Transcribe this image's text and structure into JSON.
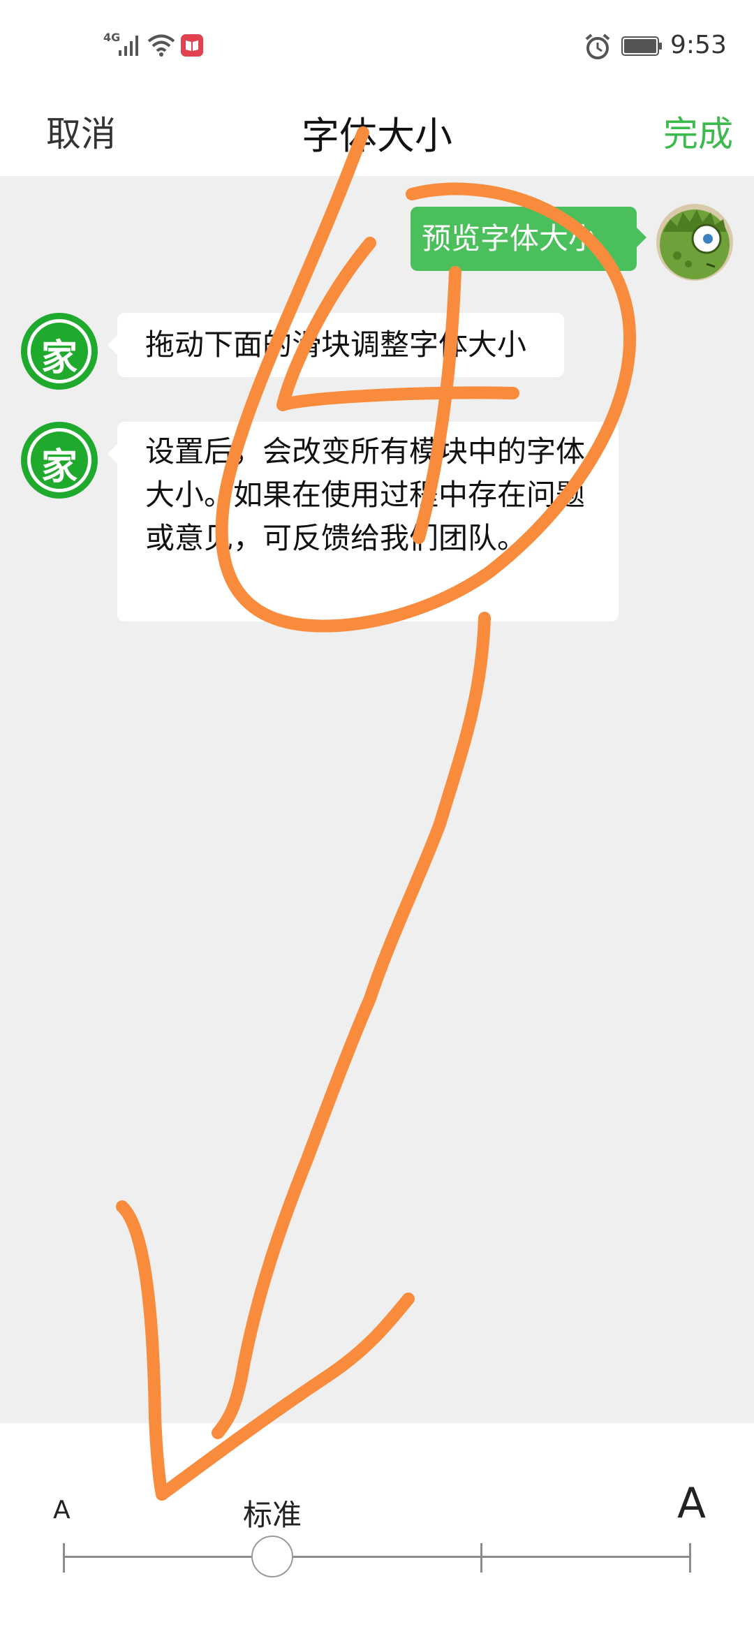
{
  "status_bar": {
    "network": "4G",
    "time": "9:53",
    "icons": [
      "signal-icon",
      "wifi-icon",
      "app-notification-icon",
      "alarm-icon",
      "battery-icon"
    ]
  },
  "header": {
    "cancel_label": "取消",
    "title": "字体大小",
    "done_label": "完成"
  },
  "chat": {
    "outgoing_message": "预览字体大小",
    "bot_avatar_glyph": "家",
    "incoming_messages": [
      "拖动下面的滑块调整字体大小",
      "设置后，会改变所有模块中的字体大小。如果在使用过程中存在问题或意见，可反馈给我们团队。"
    ]
  },
  "font_slider": {
    "small_label": "A",
    "standard_label": "标准",
    "large_label": "A",
    "steps": 4,
    "selected_step": 2
  },
  "colors": {
    "accent_green": "#3dba4e",
    "bubble_green": "#4cbf5d",
    "bot_green": "#1faa2e",
    "chat_background": "#efefef",
    "annotation_orange": "#f98c3c"
  }
}
